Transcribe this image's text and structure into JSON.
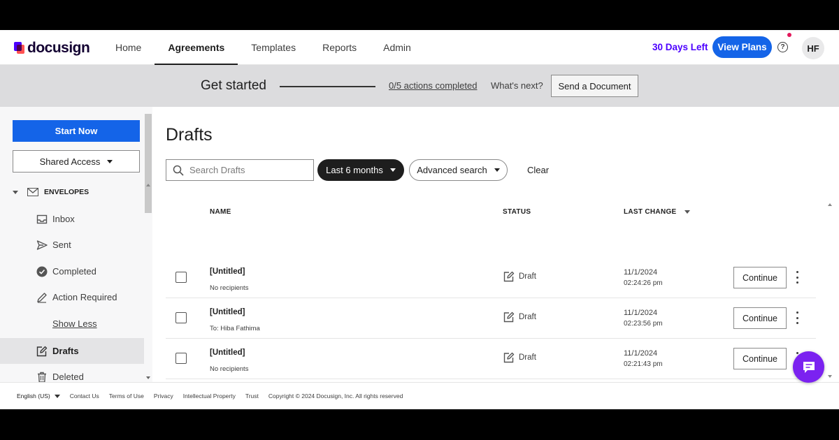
{
  "header": {
    "logo": "docusign",
    "nav": [
      "Home",
      "Agreements",
      "Templates",
      "Reports",
      "Admin"
    ],
    "active_nav": "Agreements",
    "days_left": "30 Days Left",
    "view_plans": "View Plans",
    "avatar": "HF"
  },
  "get_started": {
    "title": "Get started",
    "actions_completed": "0/5 actions completed",
    "whats_next": "What's next?",
    "send_document": "Send a Document"
  },
  "sidebar": {
    "start_now": "Start Now",
    "shared_access": "Shared Access",
    "envelopes_label": "ENVELOPES",
    "items": [
      {
        "label": "Inbox",
        "icon": "inbox-icon"
      },
      {
        "label": "Sent",
        "icon": "send-icon"
      },
      {
        "label": "Completed",
        "icon": "check-circle-icon"
      },
      {
        "label": "Action Required",
        "icon": "pen-icon"
      },
      {
        "label": "Show Less",
        "icon": ""
      },
      {
        "label": "Drafts",
        "icon": "draft-icon"
      },
      {
        "label": "Deleted",
        "icon": "trash-icon"
      }
    ],
    "active_item": "Drafts"
  },
  "main": {
    "title": "Drafts",
    "search_placeholder": "Search Drafts",
    "date_filter": "Last 6 months",
    "advanced_search": "Advanced search",
    "clear": "Clear",
    "columns": {
      "name": "NAME",
      "status": "STATUS",
      "last_change": "LAST CHANGE"
    },
    "rows": [
      {
        "name": "[Untitled]",
        "recipients": "No recipients",
        "status": "Draft",
        "date": "11/1/2024",
        "time": "02:24:26 pm",
        "action": "Continue"
      },
      {
        "name": "[Untitled]",
        "recipients": "To: Hiba Fathima",
        "status": "Draft",
        "date": "11/1/2024",
        "time": "02:23:56 pm",
        "action": "Continue"
      },
      {
        "name": "[Untitled]",
        "recipients": "No recipients",
        "status": "Draft",
        "date": "11/1/2024",
        "time": "02:21:43 pm",
        "action": "Continue"
      }
    ]
  },
  "footer": {
    "language": "English (US)",
    "links": [
      "Contact Us",
      "Terms of Use",
      "Privacy",
      "Intellectual Property",
      "Trust"
    ],
    "copyright": "Copyright © 2024 Docusign, Inc. All rights reserved"
  },
  "colors": {
    "primary": "#1464e8",
    "brand_purple": "#4c00ff",
    "chat_purple": "#7b22f0",
    "band_gray": "#dcdcde"
  }
}
